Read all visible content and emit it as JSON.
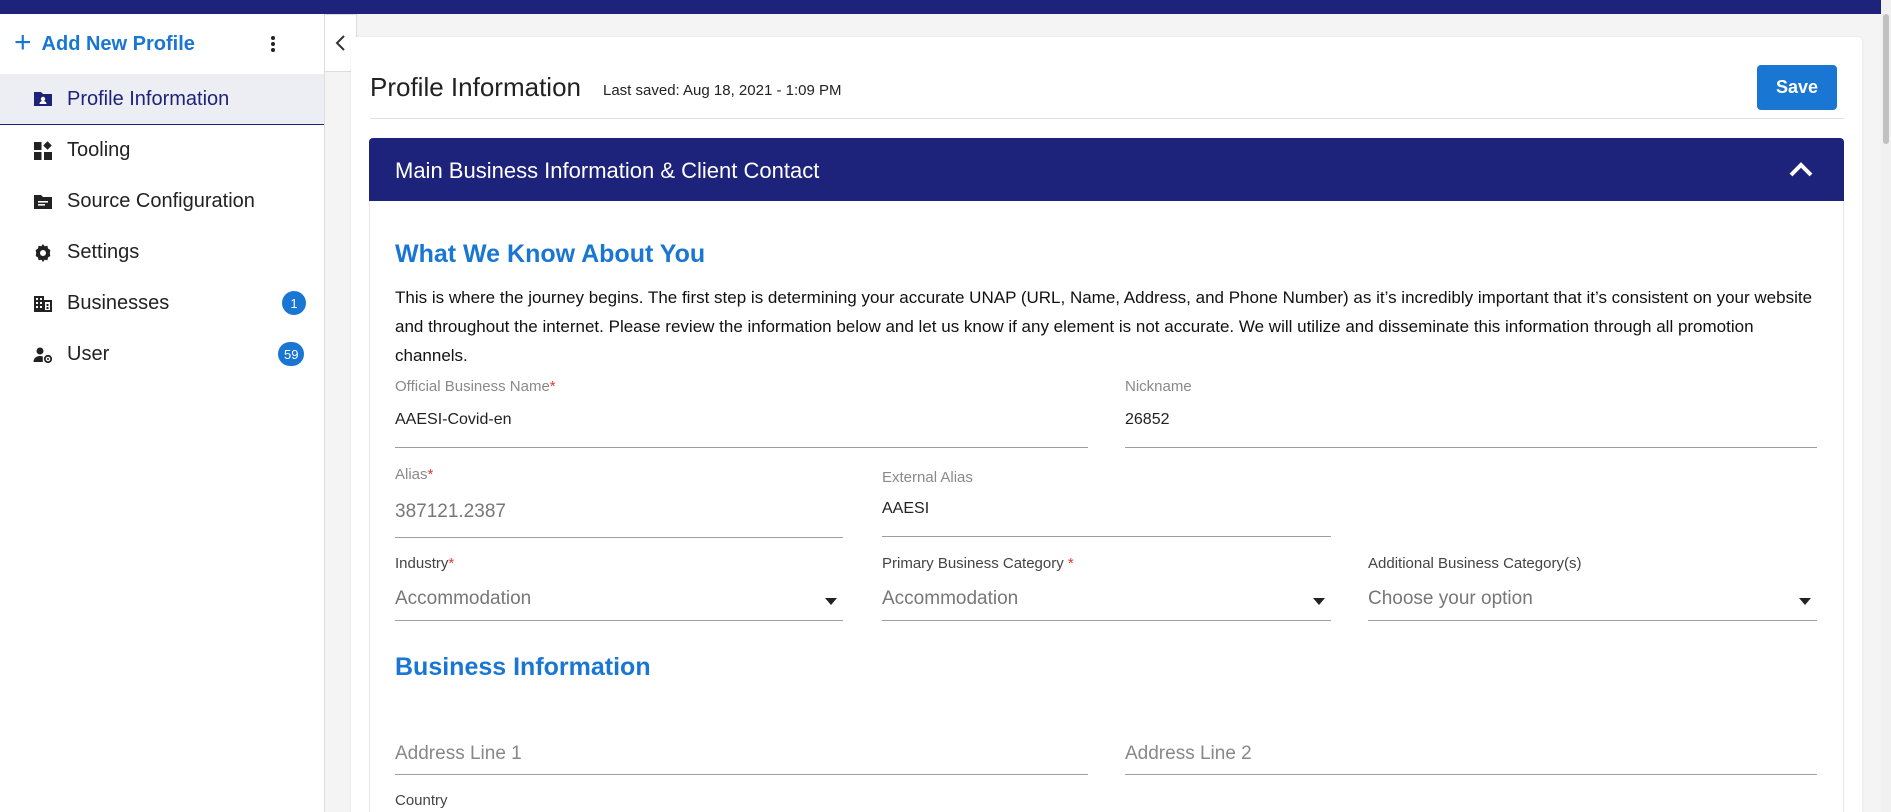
{
  "sidebar": {
    "add_label": "Add New Profile",
    "items": [
      {
        "label": "Profile Information",
        "icon": "profile-folder-icon",
        "badge": null
      },
      {
        "label": "Tooling",
        "icon": "widgets-icon",
        "badge": null
      },
      {
        "label": "Source Configuration",
        "icon": "source-folder-icon",
        "badge": null
      },
      {
        "label": "Settings",
        "icon": "gear-icon",
        "badge": null
      },
      {
        "label": "Businesses",
        "icon": "building-icon",
        "badge": "1"
      },
      {
        "label": "User",
        "icon": "user-settings-icon",
        "badge": "59"
      }
    ]
  },
  "header": {
    "title": "Profile Information",
    "last_saved": "Last saved: Aug 18, 2021 - 1:09 PM",
    "save_label": "Save"
  },
  "section": {
    "title": "Main Business Information & Client Contact"
  },
  "about": {
    "heading": "What We Know About You",
    "text": "This is where the journey begins. The first step is determining your accurate UNAP (URL, Name, Address, and Phone Number) as it’s incredibly important that it’s consistent on your website and throughout the internet. Please review the information below and let us know if any element is not accurate. We will utilize and disseminate this information through all promotion channels."
  },
  "fields": {
    "official_name": {
      "label": "Official Business Name",
      "value": "AAESI-Covid-en"
    },
    "nickname": {
      "label": "Nickname",
      "value": "26852"
    },
    "alias": {
      "label": "Alias",
      "value": "387121.2387"
    },
    "external_alias": {
      "label": "External Alias",
      "value": "AAESI"
    },
    "industry": {
      "label": "Industry",
      "value": "Accommodation"
    },
    "primary_category": {
      "label": "Primary Business Category ",
      "value": "Accommodation"
    },
    "additional_category": {
      "label": "Additional Business Category(s)",
      "value": "Choose your option"
    }
  },
  "business": {
    "heading": "Business Information",
    "address1_placeholder": "Address Line 1",
    "address2_placeholder": "Address Line 2",
    "country_label": "Country"
  },
  "colors": {
    "navy": "#1d237b",
    "accent": "#1976d2",
    "required": "#e53935"
  }
}
